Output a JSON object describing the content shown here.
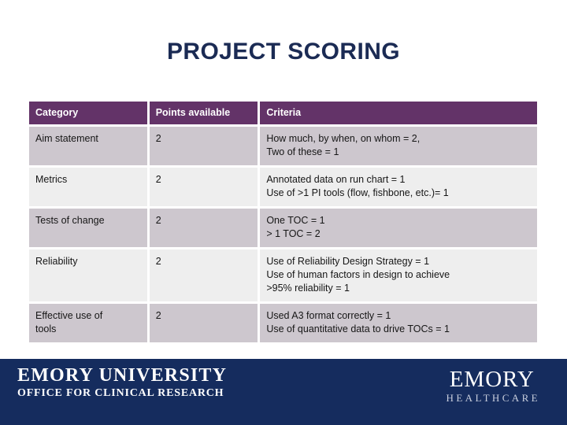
{
  "slide": {
    "title": "PROJECT SCORING",
    "title_color": "#1b2b54",
    "background_color": "#ffffff"
  },
  "table": {
    "header_background": "#633368",
    "header_text_color": "#ffffff",
    "row_odd_background": "#cdc7ce",
    "row_even_background": "#eeeeee",
    "columns": [
      {
        "key": "category",
        "label": "Category"
      },
      {
        "key": "points",
        "label": "Points available"
      },
      {
        "key": "criteria",
        "label": "Criteria"
      }
    ],
    "rows": [
      {
        "category": "Aim statement",
        "points": "2",
        "criteria_lines": [
          "How much, by when, on whom = 2,",
          "Two of these = 1"
        ]
      },
      {
        "category": "Metrics",
        "points": "2",
        "criteria_lines": [
          "Annotated data on run chart = 1",
          "Use of >1 PI tools (flow, fishbone, etc.)= 1"
        ]
      },
      {
        "category": "Tests of change",
        "points": "2",
        "criteria_lines": [
          "One TOC = 1",
          "> 1 TOC = 2"
        ]
      },
      {
        "category": "Reliability",
        "points": "2",
        "criteria_lines": [
          "Use of Reliability Design Strategy = 1",
          "Use of human factors in design to achieve",
          ">95% reliability = 1"
        ]
      },
      {
        "category_lines": [
          "Effective use of",
          "tools"
        ],
        "points": "2",
        "criteria_lines": [
          "Used A3 format correctly = 1",
          "Use of quantitative data to drive TOCs = 1"
        ]
      }
    ]
  },
  "footer": {
    "background_color": "#152c5e",
    "university": {
      "name": "EMORY UNIVERSITY",
      "office": "OFFICE FOR CLINICAL RESEARCH"
    },
    "healthcare": {
      "word": "EMORY",
      "sub": "HEALTHCARE",
      "sub_color": "#c8cedd"
    }
  }
}
